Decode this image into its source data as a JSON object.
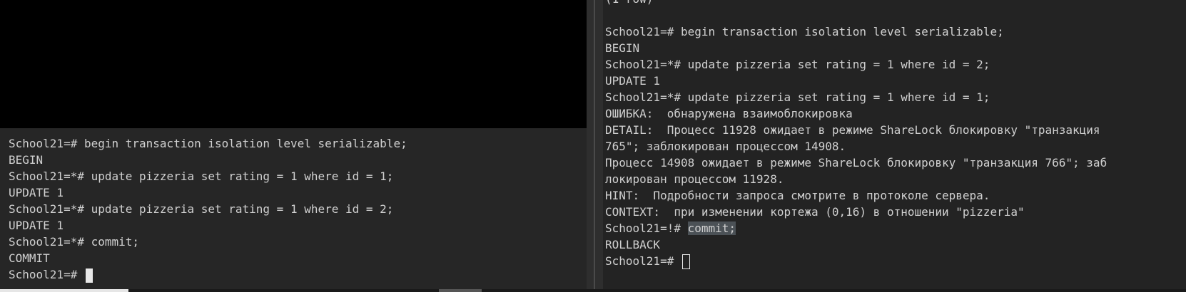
{
  "left_terminal": {
    "lines": [
      "School21=# begin transaction isolation level serializable;",
      "BEGIN",
      "School21=*# update pizzeria set rating = 1 where id = 1;",
      "UPDATE 1",
      "School21=*# update pizzeria set rating = 1 where id = 2;",
      "UPDATE 1",
      "School21=*# commit;",
      "COMMIT"
    ],
    "prompt": "School21=# "
  },
  "right_terminal": {
    "top_partial": "(1 row)",
    "lines": [
      "",
      "School21=# begin transaction isolation level serializable;",
      "BEGIN",
      "School21=*# update pizzeria set rating = 1 where id = 2;",
      "UPDATE 1",
      "School21=*# update pizzeria set rating = 1 where id = 1;",
      "ОШИБКА:  обнаружена взаимоблокировка",
      "DETAIL:  Процесс 11928 ожидает в режиме ShareLock блокировку \"транзакция",
      "765\"; заблокирован процессом 14908.",
      "Процесс 14908 ожидает в режиме ShareLock блокировку \"транзакция 766\"; заб",
      "локирован процессом 11928.",
      "HINT:  Подробности запроса смотрите в протоколе сервера.",
      "CONTEXT:  при изменении кортежа (0,16) в отношении \"pizzeria\""
    ],
    "commit_prompt": "School21=!# ",
    "commit_command": "commit;",
    "rollback": "ROLLBACK",
    "prompt": "School21=# "
  }
}
